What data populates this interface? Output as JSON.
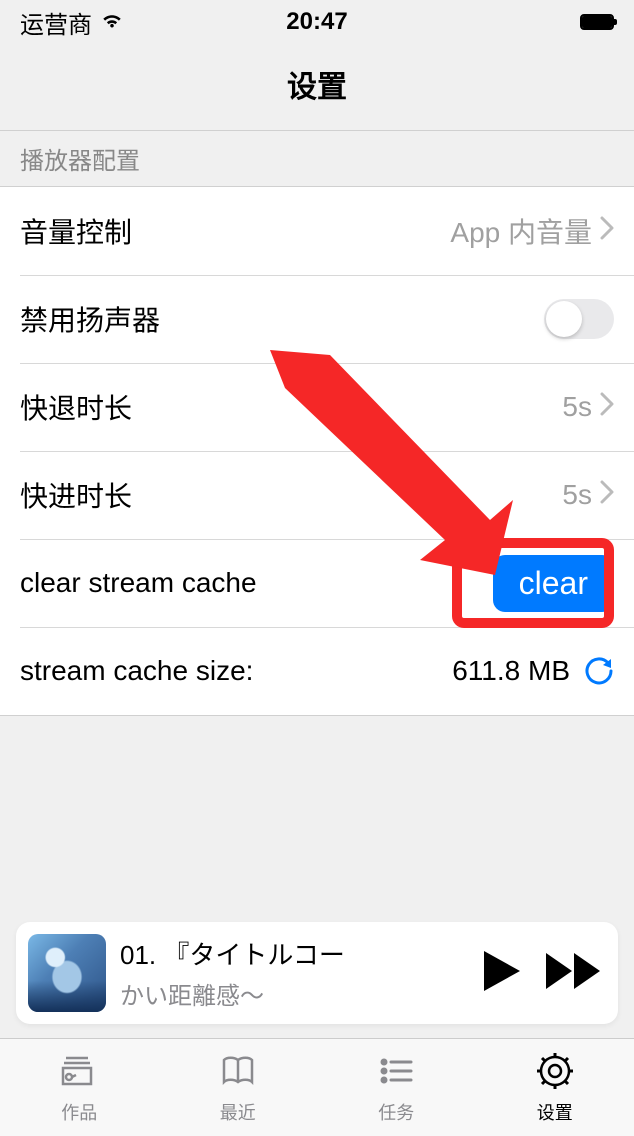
{
  "status": {
    "carrier": "运营商",
    "time": "20:47"
  },
  "nav": {
    "title": "设置"
  },
  "section": {
    "player_config": "播放器配置"
  },
  "rows": {
    "volume": {
      "label": "音量控制",
      "value": "App 内音量"
    },
    "disable_speaker": {
      "label": "禁用扬声器",
      "on": false
    },
    "rewind": {
      "label": "快退时长",
      "value": "5s"
    },
    "forward": {
      "label": "快进时长",
      "value": "5s"
    },
    "clear_cache": {
      "label": "clear stream cache",
      "button": "clear"
    },
    "cache_size": {
      "label": "stream cache size:",
      "value": "611.8 MB"
    }
  },
  "player": {
    "title": "01. 『タイトルコー",
    "subtitle": "かい距離感〜"
  },
  "tabs": {
    "works": "作品",
    "recent": "最近",
    "tasks": "任务",
    "settings": "设置"
  }
}
